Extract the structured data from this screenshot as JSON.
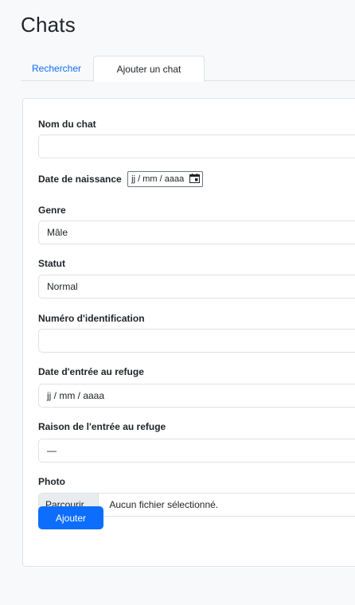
{
  "page": {
    "title": "Chats"
  },
  "tabs": [
    {
      "label": "Rechercher",
      "active": false
    },
    {
      "label": "Ajouter un chat",
      "active": true
    }
  ],
  "form": {
    "name": {
      "label": "Nom du chat",
      "value": ""
    },
    "birth_date": {
      "label": "Date de naissance",
      "value": "jj / mm / aaaa"
    },
    "gender": {
      "label": "Genre",
      "value": "Mâle"
    },
    "status": {
      "label": "Statut",
      "value": "Normal"
    },
    "identification": {
      "label": "Numéro d'identification",
      "value": ""
    },
    "entry_date": {
      "label": "Date d'entrée au refuge",
      "value": "jj / mm / aaaa"
    },
    "entry_reason": {
      "label": "Raison de l'entrée au refuge",
      "value": "—"
    },
    "photo": {
      "label": "Photo",
      "browse_label": "Parcourir...",
      "file_status": "Aucun fichier sélectionné."
    },
    "submit_label": "Ajouter"
  },
  "colors": {
    "accent": "#0d6efd",
    "border": "#dee2e6",
    "background": "#f8f9fa"
  }
}
